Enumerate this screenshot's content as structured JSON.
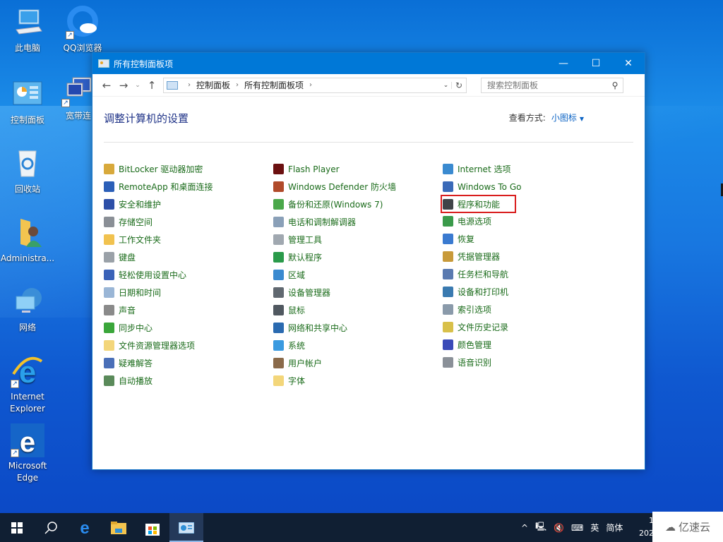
{
  "desktop": {
    "icons": [
      {
        "label": "此电脑",
        "icon": "computer-icon",
        "shortcut": false
      },
      {
        "label": "QQ浏览器",
        "icon": "qq-browser-icon",
        "shortcut": true
      },
      {
        "label": "控制面板",
        "icon": "control-panel-icon",
        "shortcut": false
      },
      {
        "label": "宽带连",
        "icon": "broadband-icon",
        "shortcut": true
      },
      {
        "label": "回收站",
        "icon": "recycle-bin-icon",
        "shortcut": false
      },
      {
        "label": "Administra...",
        "icon": "user-folder-icon",
        "shortcut": false
      },
      {
        "label": "网络",
        "icon": "network-icon",
        "shortcut": false
      },
      {
        "label": "Internet Explorer",
        "icon": "ie-icon",
        "shortcut": true
      },
      {
        "label": "Microsoft Edge",
        "icon": "edge-icon",
        "shortcut": true
      }
    ]
  },
  "window": {
    "title": "所有控制面板项",
    "controls": {
      "minimize": "—",
      "maximize": "☐",
      "close": "✕"
    },
    "nav": {
      "back": "←",
      "forward": "→",
      "recent": "⌄",
      "up": "↑"
    },
    "breadcrumb": [
      "控制面板",
      "所有控制面板项"
    ],
    "search_placeholder": "搜索控制面板",
    "heading": "调整计算机的设置",
    "view_by_label": "查看方式:",
    "view_by_value": "小图标",
    "highlight_color": "#d91d1d",
    "link_color": "#1a6b1a",
    "columns": [
      [
        {
          "label": "BitLocker 驱动器加密",
          "icon": "bitlocker-icon"
        },
        {
          "label": "RemoteApp 和桌面连接",
          "icon": "remoteapp-icon"
        },
        {
          "label": "安全和维护",
          "icon": "flag-icon"
        },
        {
          "label": "存储空间",
          "icon": "storage-icon"
        },
        {
          "label": "工作文件夹",
          "icon": "work-folders-icon"
        },
        {
          "label": "键盘",
          "icon": "keyboard-icon"
        },
        {
          "label": "轻松使用设置中心",
          "icon": "ease-of-access-icon"
        },
        {
          "label": "日期和时间",
          "icon": "date-time-icon"
        },
        {
          "label": "声音",
          "icon": "sound-icon"
        },
        {
          "label": "同步中心",
          "icon": "sync-center-icon"
        },
        {
          "label": "文件资源管理器选项",
          "icon": "explorer-options-icon"
        },
        {
          "label": "疑难解答",
          "icon": "troubleshoot-icon"
        },
        {
          "label": "自动播放",
          "icon": "autoplay-icon"
        }
      ],
      [
        {
          "label": "Flash Player",
          "icon": "flash-icon"
        },
        {
          "label": "Windows Defender 防火墙",
          "icon": "firewall-icon"
        },
        {
          "label": "备份和还原(Windows 7)",
          "icon": "backup-icon"
        },
        {
          "label": "电话和调制解调器",
          "icon": "phone-modem-icon"
        },
        {
          "label": "管理工具",
          "icon": "admin-tools-icon"
        },
        {
          "label": "默认程序",
          "icon": "default-programs-icon"
        },
        {
          "label": "区域",
          "icon": "region-icon"
        },
        {
          "label": "设备管理器",
          "icon": "device-manager-icon"
        },
        {
          "label": "鼠标",
          "icon": "mouse-icon"
        },
        {
          "label": "网络和共享中心",
          "icon": "network-sharing-icon"
        },
        {
          "label": "系统",
          "icon": "system-icon"
        },
        {
          "label": "用户帐户",
          "icon": "user-accounts-icon"
        },
        {
          "label": "字体",
          "icon": "fonts-icon"
        }
      ],
      [
        {
          "label": "Internet 选项",
          "icon": "internet-options-icon"
        },
        {
          "label": "Windows To Go",
          "icon": "windows-to-go-icon"
        },
        {
          "label": "程序和功能",
          "icon": "programs-features-icon",
          "highlighted": true
        },
        {
          "label": "电源选项",
          "icon": "power-options-icon"
        },
        {
          "label": "恢复",
          "icon": "recovery-icon"
        },
        {
          "label": "凭据管理器",
          "icon": "credential-manager-icon"
        },
        {
          "label": "任务栏和导航",
          "icon": "taskbar-nav-icon"
        },
        {
          "label": "设备和打印机",
          "icon": "devices-printers-icon"
        },
        {
          "label": "索引选项",
          "icon": "indexing-icon"
        },
        {
          "label": "文件历史记录",
          "icon": "file-history-icon"
        },
        {
          "label": "颜色管理",
          "icon": "color-management-icon"
        },
        {
          "label": "语音识别",
          "icon": "speech-recognition-icon"
        }
      ]
    ]
  },
  "taskbar": {
    "apps": [
      "start-icon",
      "search-icon",
      "edge-icon",
      "file-explorer-icon",
      "store-icon",
      "control-panel-icon"
    ],
    "active": "control-panel-icon",
    "tray": {
      "chevron": "^",
      "ime_lang": "英",
      "ime_mode": "简体"
    },
    "clock_partial_time": "1",
    "clock_partial_date": "202"
  },
  "watermark": "亿速云"
}
